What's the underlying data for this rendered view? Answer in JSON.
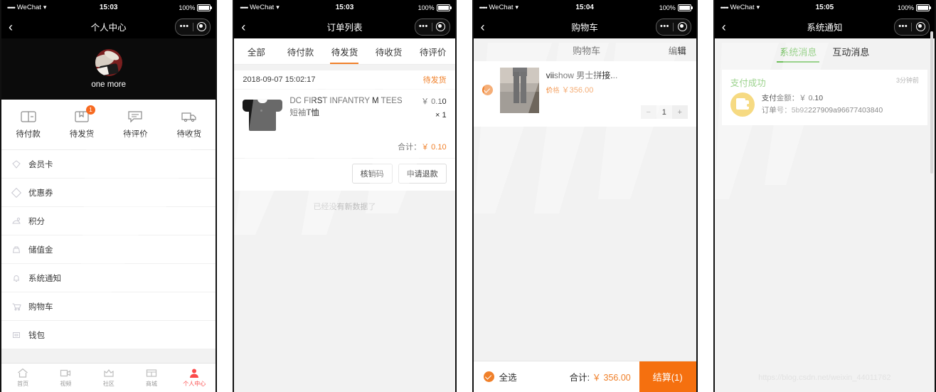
{
  "statusbar": {
    "carrier": "WeChat",
    "dots": "•••••",
    "wifi": "▾",
    "battery": "100%",
    "times": [
      "15:03",
      "15:03",
      "15:04",
      "15:05"
    ]
  },
  "navcaps": {
    "dots": "•••"
  },
  "panel1": {
    "nav_title": "个人中心",
    "back_icon": "chevron-left-icon",
    "user_name": "one more",
    "quick_orders": [
      {
        "label": "待付款",
        "icon": "wallet-pay-icon",
        "badge": ""
      },
      {
        "label": "待发货",
        "icon": "package-ship-icon",
        "badge": "1"
      },
      {
        "label": "待评价",
        "icon": "comment-icon",
        "badge": ""
      },
      {
        "label": "待收货",
        "icon": "truck-icon",
        "badge": ""
      }
    ],
    "menu": [
      {
        "label": "会员卡",
        "icon": "membership-card-icon"
      },
      {
        "label": "优惠券",
        "icon": "coupon-icon"
      },
      {
        "label": "积分",
        "icon": "points-icon"
      },
      {
        "label": "储值金",
        "icon": "savings-icon"
      },
      {
        "label": "系统通知",
        "icon": "bell-icon"
      },
      {
        "label": "购物车",
        "icon": "cart-icon"
      },
      {
        "label": "钱包",
        "icon": "wallet-icon"
      }
    ],
    "tabbar": [
      {
        "label": "首页",
        "icon": "home-icon",
        "active": false
      },
      {
        "label": "视频",
        "icon": "video-icon",
        "active": false
      },
      {
        "label": "社区",
        "icon": "community-icon",
        "active": false
      },
      {
        "label": "商城",
        "icon": "store-icon",
        "active": false
      },
      {
        "label": "个人中心",
        "icon": "user-icon",
        "active": true
      }
    ]
  },
  "panel2": {
    "nav_title": "订单列表",
    "tabs": [
      {
        "label": "全部",
        "active": false
      },
      {
        "label": "待付款",
        "active": false
      },
      {
        "label": "待发货",
        "active": true
      },
      {
        "label": "待收货",
        "active": false
      },
      {
        "label": "待评价",
        "active": false
      }
    ],
    "order": {
      "date": "2018-09-07 15:02:17",
      "status": "待发货",
      "product_name": "DC FIRST INFANTRY M TEES 短袖T恤",
      "price": "￥ 0.10",
      "qty": "× 1",
      "total_label": "合计：",
      "total_amount": "￥ 0.10",
      "actions": [
        "核销码",
        "申请退款"
      ]
    },
    "no_more": "已经没有新数据了"
  },
  "panel3": {
    "nav_title": "购物车",
    "page_title": "购物车",
    "edit_label": "编辑",
    "item": {
      "name": "viishow 男士拼接...",
      "price_label": "价格",
      "price": "￥356.00",
      "qty": "1",
      "minus": "−",
      "plus": "+"
    },
    "bottom": {
      "select_all": "全选",
      "total_label": "合计:",
      "total_amount": "￥ 356.00",
      "checkout": "结算(1)"
    }
  },
  "panel4": {
    "nav_title": "系统通知",
    "tabs": [
      {
        "label": "系统消息",
        "active": true
      },
      {
        "label": "互动消息",
        "active": false
      }
    ],
    "notification": {
      "title": "支付成功",
      "time": "3分钟前",
      "amount_line": "支付金额：￥ 0.10",
      "order_line": "订单号：5b92227909a96677403840",
      "icon": "wallet-icon"
    },
    "watermark_url": "https://blog.csdn.net/weixin_44011762"
  },
  "colors": {
    "orange": "#f0802a",
    "checkout_orange": "#f5700f",
    "green": "#6fbf5b",
    "red": "#fb4a4a",
    "gold": "#f2ca4c",
    "nav_black": "#000000"
  }
}
